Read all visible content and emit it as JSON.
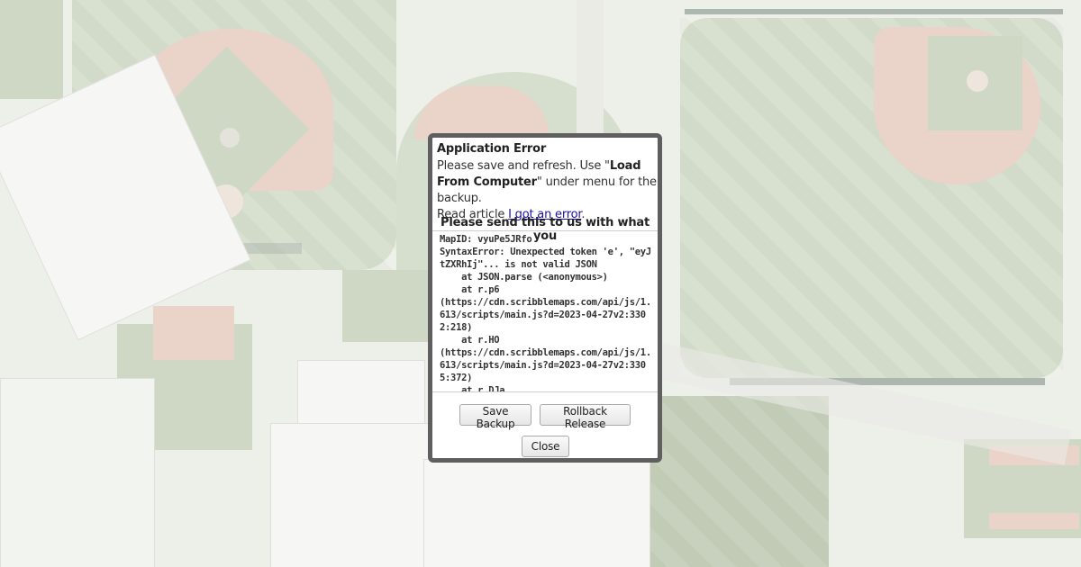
{
  "dialog": {
    "title": "Application Error",
    "message_prefix": "Please save and refresh. Use \"",
    "message_bold": "Load From Computer",
    "message_suffix": "\" under menu for the backup.",
    "read_prefix": "Read article ",
    "read_link": "I got an error",
    "read_suffix": ".",
    "send_heading": "Please send this to us with what you",
    "error_log": "MapID: vyuPe5JRfo\nSyntaxError: Unexpected token 'e', \"eyJtZXRhIj\"... is not valid JSON\n    at JSON.parse (<anonymous>)\n    at r.p6\n(https://cdn.scribblemaps.com/api/js/1.613/scripts/main.js?d=2023-04-27v2:3302:218)\n    at r.HO\n(https://cdn.scribblemaps.com/api/js/1.613/scripts/main.js?d=2023-04-27v2:3305:372)\n    at r.DJa",
    "buttons": {
      "save_backup": "Save Backup",
      "rollback_release": "Rollback Release",
      "close": "Close"
    }
  },
  "colors": {
    "dialog_border": "#5f5f5f",
    "link": "#1a0dab",
    "map_grass": "#bcc9ae",
    "map_dirt": "#e2c2b3"
  }
}
